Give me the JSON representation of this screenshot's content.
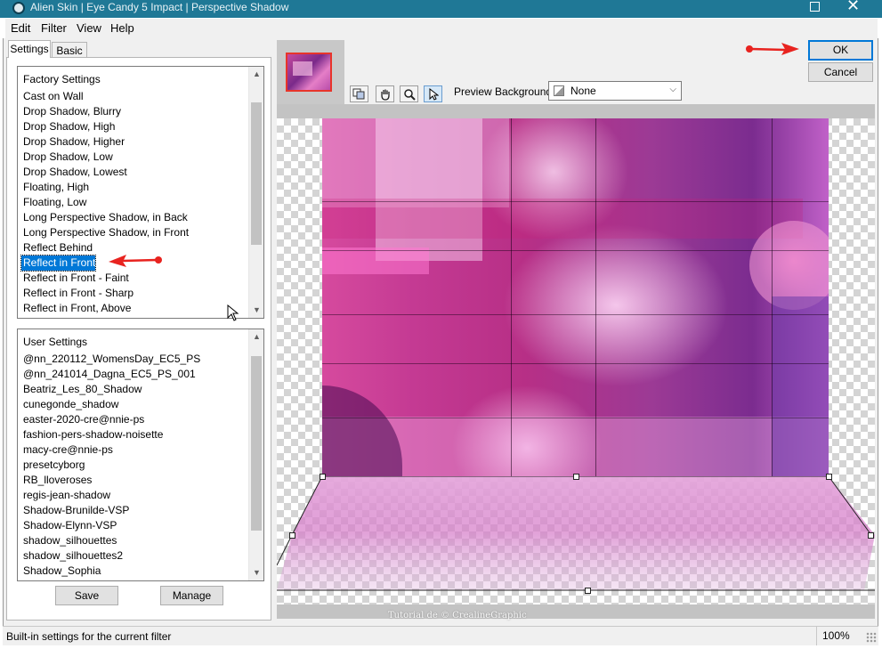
{
  "window": {
    "title": "Alien Skin | Eye Candy 5 Impact | Perspective Shadow"
  },
  "menubar": {
    "items": [
      "Edit",
      "Filter",
      "View",
      "Help"
    ]
  },
  "tabs": [
    "Settings",
    "Basic"
  ],
  "factory_settings": {
    "header": "Factory Settings",
    "items": [
      "Cast on Wall",
      "Drop Shadow, Blurry",
      "Drop Shadow, High",
      "Drop Shadow, Higher",
      "Drop Shadow, Low",
      "Drop Shadow, Lowest",
      "Floating, High",
      "Floating, Low",
      "Long Perspective Shadow, in Back",
      "Long Perspective Shadow, in Front",
      "Reflect Behind",
      "Reflect in Front",
      "Reflect in Front - Faint",
      "Reflect in Front - Sharp",
      "Reflect in Front, Above"
    ],
    "selected": "Reflect in Front"
  },
  "user_settings": {
    "header": "User Settings",
    "items": [
      "@nn_220112_WomensDay_EC5_PS",
      "@nn_241014_Dagna_EC5_PS_001",
      "Beatriz_Les_80_Shadow",
      "cunegonde_shadow",
      "easter-2020-cre@nnie-ps",
      "fashion-pers-shadow-noisette",
      "macy-cre@nnie-ps",
      "presetcyborg",
      "RB_lloveroses",
      "regis-jean-shadow",
      "Shadow-Brunilde-VSP",
      "Shadow-Elynn-VSP",
      "shadow_silhouettes",
      "shadow_silhouettes2",
      "Shadow_Sophia"
    ]
  },
  "buttons": {
    "save": "Save",
    "manage": "Manage",
    "ok": "OK",
    "cancel": "Cancel"
  },
  "toolbar": {
    "tools": [
      "preview-toggle-icon",
      "hand-icon",
      "zoom-icon",
      "pointer-icon"
    ],
    "preview_background_label": "Preview Background:",
    "preview_background_value": "None"
  },
  "status": {
    "text": "Built-in settings for the current filter",
    "zoom": "100%"
  },
  "watermark": "Tutorial de © CrealineGraphic",
  "colors": {
    "titlebar": "#1f7896",
    "selection": "#0078d7",
    "annotation_arrow": "#e8231f"
  }
}
